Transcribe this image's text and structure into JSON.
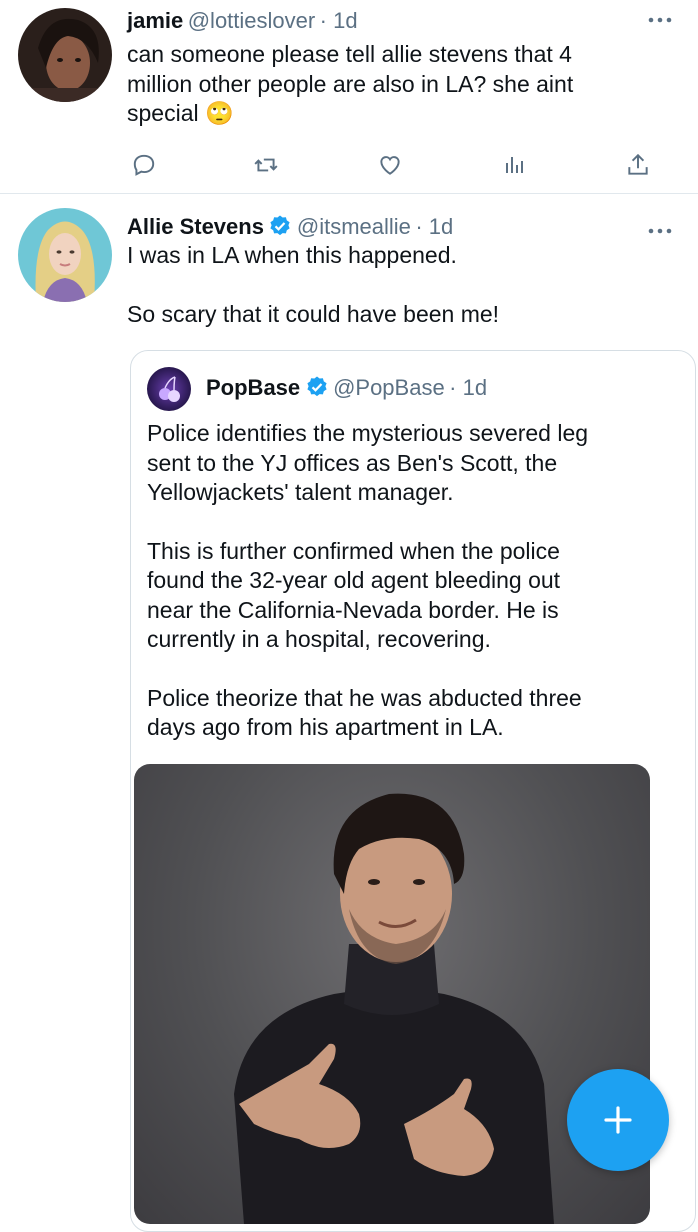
{
  "tweets": [
    {
      "name": "jamie",
      "handle": "@lottieslover",
      "time": "· 1d",
      "text_line1": "can someone please tell allie stevens that 4",
      "text_line2": "million other people are also in LA? she aint",
      "text_line3": "special",
      "emoji": "🙄"
    },
    {
      "name": "Allie Stevens",
      "handle": "@itsmeallie",
      "time": "· 1d",
      "text_line1": "I was in LA when this happened.",
      "text_line2": "So scary that it could have been me!"
    }
  ],
  "quote": {
    "name": "PopBase",
    "handle": "@PopBase",
    "time": "· 1d",
    "para1": [
      "Police identifies the mysterious severed leg",
      "sent to the YJ offices as Ben's Scott, the",
      "Yellowjackets' talent manager."
    ],
    "para2": [
      "This is further confirmed when the police",
      "found the 32-year old agent bleeding out",
      "near the California-Nevada border. He is",
      "currently in a hospital, recovering."
    ],
    "para3": [
      "Police theorize that he was abducted three",
      "days ago from his apartment in LA."
    ]
  },
  "colors": {
    "accent": "#1da1f2",
    "muted": "#5b7083",
    "verified": "#1da1f2"
  },
  "icons": {
    "actions": [
      "reply-icon",
      "retweet-icon",
      "like-icon",
      "analytics-icon",
      "share-icon"
    ],
    "more": "more-options-icon",
    "compose": "compose-plus-icon"
  }
}
